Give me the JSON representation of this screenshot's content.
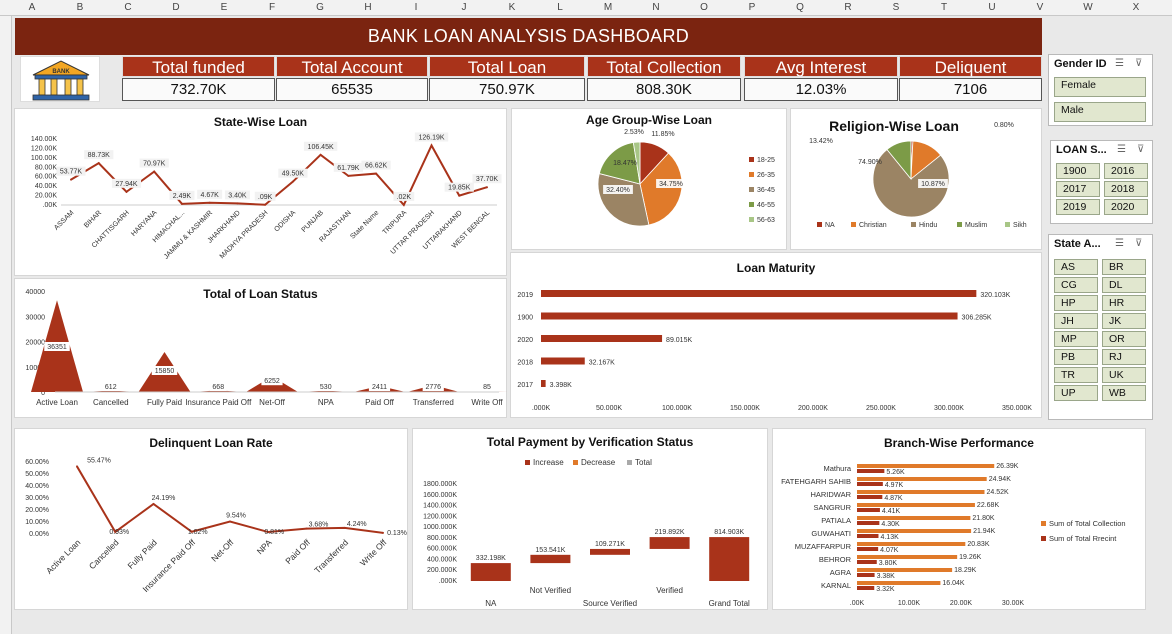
{
  "columns": [
    "A",
    "B",
    "C",
    "D",
    "E",
    "F",
    "G",
    "H",
    "I",
    "J",
    "K",
    "L",
    "M",
    "N",
    "O",
    "P",
    "Q",
    "R",
    "S",
    "T",
    "U",
    "V",
    "W",
    "X"
  ],
  "header": {
    "title": "BANK LOAN ANALYSIS DASHBOARD",
    "logo_text": "BANK"
  },
  "kpis": [
    {
      "label": "Total funded",
      "value": "732.70K"
    },
    {
      "label": "Total Account",
      "value": "65535"
    },
    {
      "label": "Total  Loan",
      "value": "750.97K"
    },
    {
      "label": "Total Collection",
      "value": "808.30K"
    },
    {
      "label": "Avg Interest",
      "value": "12.03%"
    },
    {
      "label": "Deliquent",
      "value": "7106"
    }
  ],
  "slicers": {
    "gender": {
      "title": "Gender ID",
      "items": [
        "Female",
        "Male"
      ]
    },
    "loan_year": {
      "title": "LOAN S...",
      "items": [
        "1900",
        "2016",
        "2017",
        "2018",
        "2019",
        "2020"
      ]
    },
    "state": {
      "title": "State A...",
      "items": [
        "AS",
        "BR",
        "CG",
        "DL",
        "HP",
        "HR",
        "JH",
        "JK",
        "MP",
        "OR",
        "PB",
        "RJ",
        "TR",
        "UK",
        "UP",
        "WB"
      ]
    }
  },
  "charts": {
    "state": {
      "title": "State-Wise Loan",
      "type": "line",
      "color": "#a9331a",
      "categories": [
        "ASSAM",
        "BIHAR",
        "CHATTISGARH",
        "HARYANA",
        "HIMACHAL...",
        "JAMMU & KASHMIR",
        "JHARKHAND",
        "MADHYA PRADESH",
        "ODISHA",
        "PUNJAB",
        "RAJASTHAN",
        "State Name",
        "TRIPURA",
        "UTTAR PRADESH",
        "UTTARAKHAND",
        "WEST BENGAL"
      ],
      "values": [
        53.77,
        88.73,
        27.94,
        70.97,
        2.49,
        4.67,
        3.4,
        0.5,
        49.5,
        106.45,
        61.79,
        66.62,
        0.2,
        126.19,
        19.85,
        37.7
      ],
      "labels": [
        "53.77K",
        "88.73K",
        "27.94K",
        "70.97K",
        "2.49K",
        "4.67K",
        "3.40K",
        ".09K",
        "49.50K",
        "106.45K",
        "61.79K",
        "66.62K",
        ".02K",
        "126.19K",
        "19.85K",
        "37.70K"
      ],
      "yticks": [
        "140.00K",
        "120.00K",
        "100.00K",
        "80.00K",
        "60.00K",
        "40.00K",
        "20.00K",
        ".00K"
      ],
      "ymax": 140
    },
    "age": {
      "title": "Age Group-Wise Loan",
      "type": "pie",
      "slices": [
        {
          "name": "18-25",
          "value": 11.85,
          "color": "#a9331a"
        },
        {
          "name": "26-35",
          "value": 34.75,
          "color": "#e07a2a"
        },
        {
          "name": "36-45",
          "value": 32.4,
          "color": "#9b8464"
        },
        {
          "name": "46-55",
          "value": 18.47,
          "color": "#7c9b47"
        },
        {
          "name": "56-63",
          "value": 2.53,
          "color": "#a8c686"
        }
      ],
      "labels": [
        "11.85%",
        "34.75%",
        "32.40%",
        "18.47%",
        "2.53%"
      ]
    },
    "religion": {
      "title": "Religion-Wise Loan",
      "type": "pie",
      "slices": [
        {
          "name": "NA",
          "value": 0.8,
          "color": "#a9331a"
        },
        {
          "name": "Christian",
          "value": 13.42,
          "color": "#e07a2a"
        },
        {
          "name": "Hindu",
          "value": 74.9,
          "color": "#9b8464"
        },
        {
          "name": "Muslim",
          "value": 10.87,
          "color": "#7c9b47"
        },
        {
          "name": "Sikh",
          "value": 0.01,
          "color": "#a8c686"
        }
      ],
      "labels": [
        "0.80%",
        "13.42%",
        "74.90%",
        "10.87%"
      ]
    },
    "status": {
      "title": "Total of Loan Status",
      "type": "area",
      "color": "#a9331a",
      "categories": [
        "Active Loan",
        "Cancelled",
        "Fully Paid",
        "Insurance Paid Off",
        "Net-Off",
        "NPA",
        "Paid Off",
        "Transferred",
        "Write Off"
      ],
      "values": [
        36351,
        612,
        15850,
        668,
        6252,
        530,
        2411,
        2776,
        85
      ],
      "labels": [
        "36351",
        "612",
        "15850",
        "668",
        "6252",
        "530",
        "2411",
        "2776",
        "85"
      ],
      "xlabels": [
        "Active Loan",
        "Cancelled",
        "Fully Paid",
        "Insurance Paid Off",
        "Net-Off",
        "NPA",
        "Paid Off",
        "Transferred",
        "Write Off"
      ],
      "yticks": [
        "40000",
        "30000",
        "20000",
        "10000",
        "0"
      ],
      "ymax": 40000
    },
    "maturity": {
      "title": "Loan Maturity",
      "type": "bar",
      "color": "#a9331a",
      "categories": [
        "2019",
        "1900",
        "2020",
        "2018",
        "2017"
      ],
      "values": [
        320.103,
        306.285,
        89.015,
        32.167,
        3.398
      ],
      "labels": [
        "320.103K",
        "306.285K",
        "89.015K",
        "32.167K",
        "3.398K"
      ],
      "xticks": [
        ".000K",
        "50.000K",
        "100.000K",
        "150.000K",
        "200.000K",
        "250.000K",
        "300.000K",
        "350.000K"
      ],
      "xmax": 350
    },
    "delinquent": {
      "title": "Delinquent Loan Rate",
      "type": "line",
      "color": "#a9331a",
      "categories": [
        "Active Loan",
        "Cancelled",
        "Fully Paid",
        "Insurance Paid Off",
        "Net-Off",
        "NPA",
        "Paid Off",
        "Transferred",
        "Write Off"
      ],
      "values": [
        55.47,
        0.93,
        24.19,
        1.02,
        9.54,
        0.81,
        3.68,
        4.24,
        0.13
      ],
      "labels": [
        "55.47%",
        "0.93%",
        "24.19%",
        "1.02%",
        "9.54%",
        "0.81%",
        "3.68%",
        "4.24%",
        "0.13%"
      ],
      "yticks": [
        "60.00%",
        "50.00%",
        "40.00%",
        "30.00%",
        "20.00%",
        "10.00%",
        "0.00%"
      ],
      "ymax": 60
    },
    "payment": {
      "title": "Total Payment by Verification Status",
      "type": "waterfall",
      "legend": [
        {
          "name": "Increase",
          "color": "#a9331a"
        },
        {
          "name": "Decrease",
          "color": "#e07a2a"
        },
        {
          "name": "Total",
          "color": "#a9a9a9"
        }
      ],
      "categories": [
        "NA",
        "Not Verified",
        "Source Verified",
        "Verified",
        "Grand Total"
      ],
      "values": [
        332.198,
        153.541,
        109.271,
        219.892,
        814.903
      ],
      "labels": [
        "332.198K",
        "153.541K",
        "109.271K",
        "219.892K",
        "814.903K"
      ],
      "yticks": [
        "1800.000K",
        "1600.000K",
        "1400.000K",
        "1200.000K",
        "1000.000K",
        "800.000K",
        "600.000K",
        "400.000K",
        "200.000K",
        ".000K"
      ],
      "ymax": 1800
    },
    "branch": {
      "title": "Branch-Wise Performance",
      "type": "bar",
      "categories": [
        "Mathura",
        "FATEHGARH SAHIB",
        "HARIDWAR",
        "SANGRUR",
        "PATIALA",
        "GUWAHATI",
        "MUZAFFARPUR",
        "BEHROR",
        "AGRA",
        "KARNAL"
      ],
      "series": [
        {
          "name": "Sum of Total Collection",
          "color": "#e07a2a",
          "values": [
            26.39,
            24.94,
            24.52,
            22.68,
            21.8,
            21.94,
            20.83,
            19.26,
            18.29,
            16.04
          ],
          "labels": [
            "26.39K",
            "24.94K",
            "24.52K",
            "22.68K",
            "21.80K",
            "21.94K",
            "20.83K",
            "19.26K",
            "18.29K",
            "16.04K"
          ]
        },
        {
          "name": "Sum of Total Rrecint",
          "color": "#a9331a",
          "values": [
            5.26,
            4.97,
            4.87,
            4.41,
            4.3,
            4.13,
            4.07,
            3.8,
            3.38,
            3.32
          ],
          "labels": [
            "5.26K",
            "4.97K",
            "4.87K",
            "4.41K",
            "4.30K",
            "4.13K",
            "4.07K",
            "3.80K",
            "3.38K",
            "3.32K"
          ]
        }
      ],
      "xticks": [
        ".00K",
        "10.00K",
        "20.00K",
        "30.00K"
      ],
      "xmax": 30
    }
  }
}
